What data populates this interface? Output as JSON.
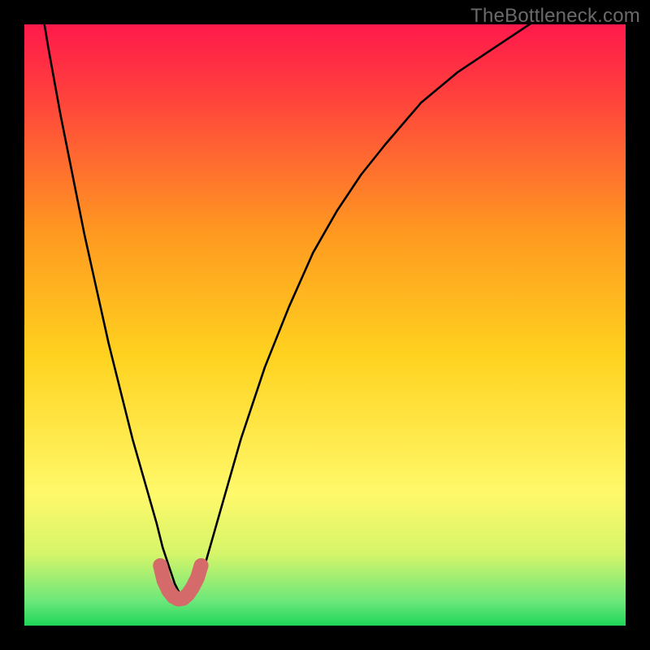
{
  "watermark": "TheBottleneck.com",
  "chart_data": {
    "type": "line",
    "title": "",
    "xlabel": "",
    "ylabel": "",
    "xlim": [
      0,
      100
    ],
    "ylim": [
      0,
      100
    ],
    "grid": false,
    "series": [
      {
        "name": "bottleneck-curve",
        "x": [
          0,
          2,
          4,
          6,
          8,
          10,
          12,
          14,
          16,
          18,
          20,
          22,
          23,
          24,
          25,
          26,
          27,
          28,
          29,
          30,
          32,
          34,
          36,
          38,
          40,
          44,
          48,
          52,
          56,
          60,
          66,
          72,
          78,
          84,
          90,
          96,
          100
        ],
        "y": [
          120,
          108,
          96,
          85,
          75,
          65,
          56,
          47,
          39,
          31,
          24,
          17,
          13,
          10,
          7,
          5,
          4,
          5,
          7,
          10,
          17,
          24,
          31,
          37,
          43,
          53,
          62,
          69,
          75,
          80,
          87,
          92,
          96,
          100,
          103,
          105.5,
          107
        ]
      },
      {
        "name": "optimal-zone-marker",
        "x": [
          22.6,
          23.2,
          24.0,
          24.8,
          25.6,
          26.4,
          27.2,
          28.0,
          28.8,
          29.4
        ],
        "y": [
          10.0,
          7.5,
          5.8,
          4.8,
          4.4,
          4.5,
          5.2,
          6.4,
          8.0,
          10.0
        ]
      }
    ],
    "bands": [
      {
        "name": "green-band",
        "y0": 0,
        "y1": 6,
        "color": "#1fd65a"
      },
      {
        "name": "fade-band",
        "y0": 6,
        "y1": 22,
        "color_top": "#fff9b0",
        "color_bottom": "#6be77a"
      }
    ],
    "background_gradient": {
      "top": "#ff1a4b",
      "mid": "#ffd21f",
      "bottom": "#1fd65a"
    }
  }
}
